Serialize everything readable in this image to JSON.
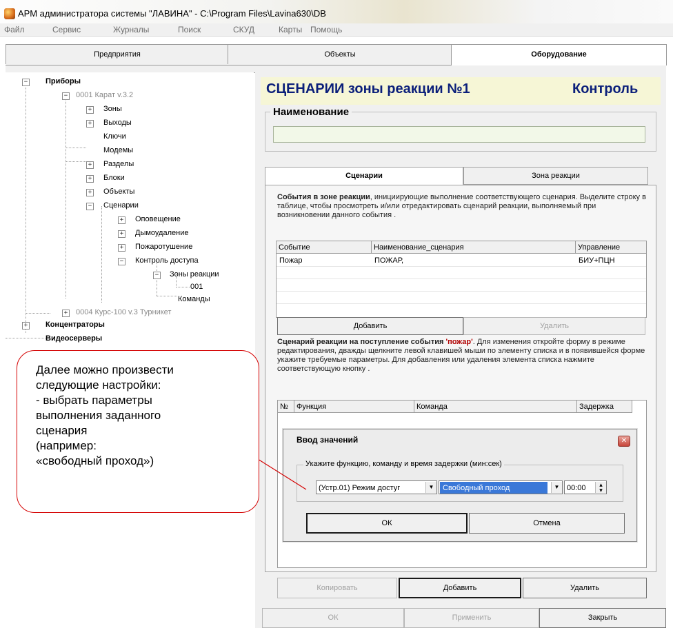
{
  "window": {
    "title": "АРМ администратора системы \"ЛАВИНА\" - C:\\Program Files\\Lavina630\\DB"
  },
  "menu": [
    "Файл",
    "Сервис",
    "Журналы",
    "Поиск",
    "СКУД",
    "Карты",
    "Помощь"
  ],
  "main_tabs": [
    "Предприятия",
    "Объекты",
    "Оборудование"
  ],
  "tree": {
    "devices": "Приборы",
    "dev1": "0001  Карат v.3.2",
    "zones": "Зоны",
    "outputs": "Выходы",
    "keys": "Ключи",
    "modems": "Модемы",
    "sections": "Разделы",
    "blocks": "Блоки",
    "objects": "Объекты",
    "scenarios": "Сценарии",
    "notify": "Оповещение",
    "smoke": "Дымоудаление",
    "fire": "Пожаротушение",
    "access": "Контроль доступа",
    "reaction_zones": "Зоны реакции",
    "zone001": "001",
    "commands": "Команды",
    "dev2": "0004  Курс-100 v.3 Турникет",
    "concentrators": "Концентраторы",
    "video": "Видеосерверы"
  },
  "banner": {
    "title": "СЦЕНАРИИ зоны реакции №1",
    "status": "Контроль"
  },
  "name_group": {
    "label": "Наименование",
    "value": ""
  },
  "inner_tabs": [
    "Сценарии",
    "Зона реакции"
  ],
  "events_intro": {
    "bold": "События в зоне реакции",
    "rest": ", инициирующие выполнение соответствующего сценария. Выделите строку в таблице, чтобы просмотреть и/или отредактировать сценарий реакции, выполняемый при возникновении данного события ."
  },
  "events_table": {
    "headers": [
      "Событие",
      "Наименование_сценария",
      "Управление"
    ],
    "rows": [
      [
        "Пожар",
        "ПОЖАР,",
        "БИУ+ПЦН"
      ]
    ]
  },
  "events_buttons": {
    "add": "Добавить",
    "delete": "Удалить"
  },
  "reaction_intro": {
    "bold": "Сценарий реакции на поступление события ",
    "event": "'пожар'",
    "rest": ". Для изменения откройте форму в режиме редактирования, дважды щелкните левой клавишей мыши по элементу списка и в появившейся форме укажите требуемые параметры. Для добавления или удаления элемента списка нажмите соответствующую кнопку ."
  },
  "functions_table": {
    "headers": [
      "№",
      "Функция",
      "Команда",
      "Задержка"
    ]
  },
  "dialog": {
    "title": "Ввод значений",
    "group_label": "Укажите функцию, команду и время задержки (мин:сек)",
    "function_value": "(Устр.01) Режим достуг",
    "command_value": "Свободный проход",
    "delay_value": "00:00",
    "ok": "ОК",
    "cancel": "Отмена"
  },
  "bottom_buttons": {
    "copy": "Копировать",
    "add": "Добавить",
    "delete": "Удалить"
  },
  "footer_buttons": {
    "ok": "ОК",
    "apply": "Применить",
    "close": "Закрыть"
  },
  "callout": {
    "lines": [
      "Далее можно произвести",
      "следующие настройки:",
      "- выбрать параметры",
      "выполнения заданного",
      "сценария",
      "(например:",
      "«свободный проход»)"
    ]
  },
  "colors": {
    "banner_bg": "#f6f6d6",
    "banner_text": "#0b1f7a",
    "highlight": "#3a78d8",
    "callout_border": "#d40000",
    "event_red": "#b00000"
  }
}
